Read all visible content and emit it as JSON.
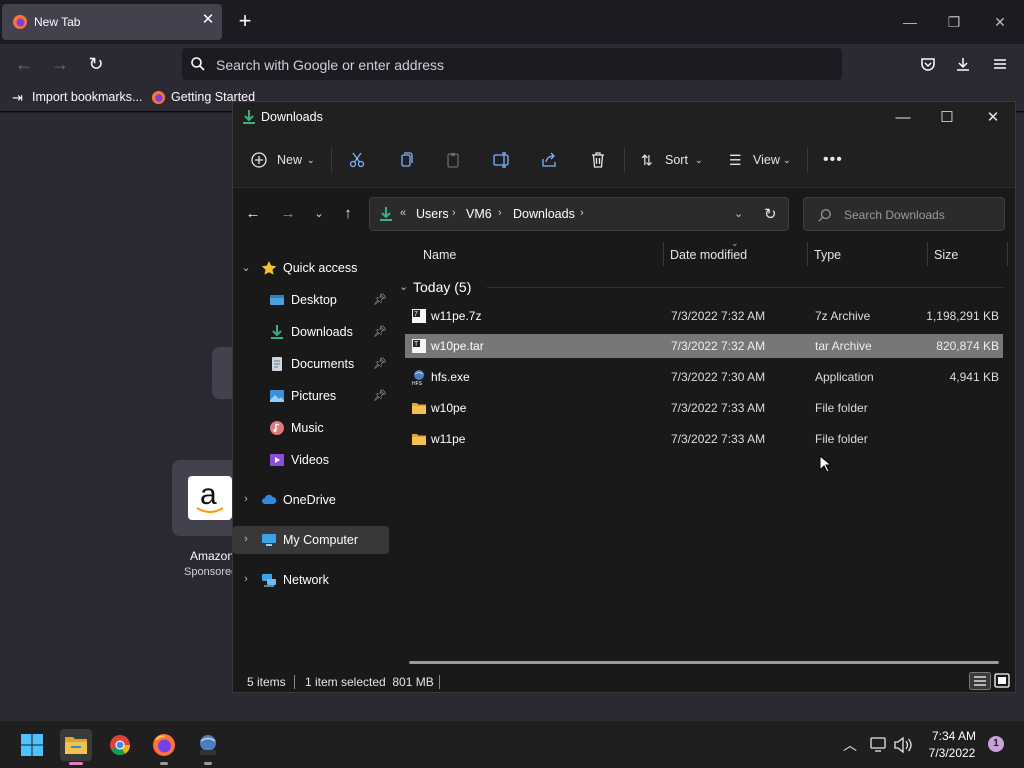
{
  "browser": {
    "tab_title": "New Tab",
    "address_placeholder": "Search with Google or enter address",
    "bookmarks": [
      "Import bookmarks...",
      "Getting Started"
    ],
    "shortcut": {
      "name": "Amazon",
      "sub": "Sponsored"
    }
  },
  "explorer": {
    "window_title": "Downloads",
    "toolbar": {
      "new_label": "New",
      "sort_label": "Sort",
      "view_label": "View"
    },
    "breadcrumb": [
      "Users",
      "VM6",
      "Downloads"
    ],
    "breadcrumb_overflow": "«",
    "search_placeholder": "Search Downloads",
    "nav_items": [
      {
        "label": "Quick access",
        "icon": "star-icon"
      },
      {
        "label": "Desktop",
        "icon": "desktop-icon",
        "pinned": true
      },
      {
        "label": "Downloads",
        "icon": "download-icon",
        "pinned": true
      },
      {
        "label": "Documents",
        "icon": "document-icon",
        "pinned": true
      },
      {
        "label": "Pictures",
        "icon": "picture-icon",
        "pinned": true
      },
      {
        "label": "Music",
        "icon": "music-icon"
      },
      {
        "label": "Videos",
        "icon": "video-icon"
      },
      {
        "label": "OneDrive",
        "icon": "cloud-icon"
      },
      {
        "label": "My Computer",
        "icon": "computer-icon",
        "selected": true
      },
      {
        "label": "Network",
        "icon": "network-icon"
      }
    ],
    "columns": [
      "Name",
      "Date modified",
      "Type",
      "Size"
    ],
    "group_header": "Today (5)",
    "files": [
      {
        "name": "w11pe.7z",
        "date": "7/3/2022 7:32 AM",
        "type": "7z Archive",
        "size": "1,198,291 KB",
        "icon": "archive-icon"
      },
      {
        "name": "w10pe.tar",
        "date": "7/3/2022 7:32 AM",
        "type": "tar Archive",
        "size": "820,874 KB",
        "icon": "archive-icon",
        "selected": true
      },
      {
        "name": "hfs.exe",
        "date": "7/3/2022 7:30 AM",
        "type": "Application",
        "size": "4,941 KB",
        "icon": "application-icon"
      },
      {
        "name": "w10pe",
        "date": "7/3/2022 7:33 AM",
        "type": "File folder",
        "size": "",
        "icon": "folder-icon"
      },
      {
        "name": "w11pe",
        "date": "7/3/2022 7:33 AM",
        "type": "File folder",
        "size": "",
        "icon": "folder-icon"
      }
    ],
    "status": {
      "count": "5 items",
      "selection": "1 item selected  801 MB"
    }
  },
  "taskbar": {
    "time": "7:34 AM",
    "date": "7/3/2022",
    "notifications": "1"
  },
  "colors": {
    "accent_download": "#36b37e",
    "folder": "#f2c14e",
    "selected_row": "#777777"
  }
}
